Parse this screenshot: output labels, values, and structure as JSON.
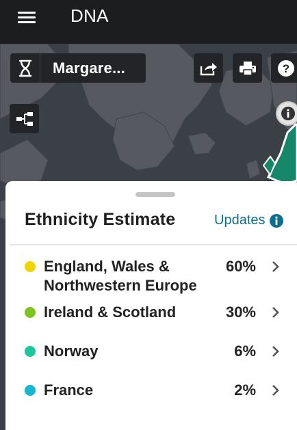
{
  "topbar": {
    "menu_icon": "hamburger-menu-icon",
    "title": "DNA"
  },
  "toolbar": {
    "profile_icon": "dna-helix-icon",
    "profile_name": "Margare...",
    "share_icon": "share-icon",
    "print_icon": "print-icon",
    "help_icon": "help-icon",
    "tree_icon": "tree-icon",
    "map_info_icon": "info-icon"
  },
  "sheet": {
    "title": "Ethnicity Estimate",
    "updates_label": "Updates",
    "updates_icon": "info-icon",
    "regions": [
      {
        "name": "England, Wales & Northwestern Europe",
        "percent": "60%",
        "color": "#f2d400"
      },
      {
        "name": "Ireland & Scotland",
        "percent": "30%",
        "color": "#7cc41e"
      },
      {
        "name": "Norway",
        "percent": "6%",
        "color": "#1cc79a"
      },
      {
        "name": "France",
        "percent": "2%",
        "color": "#13b7cf"
      }
    ]
  },
  "colors": {
    "accent": "#0d6f90",
    "topbar": "#1c1d1f",
    "map_region": "#17876a"
  }
}
